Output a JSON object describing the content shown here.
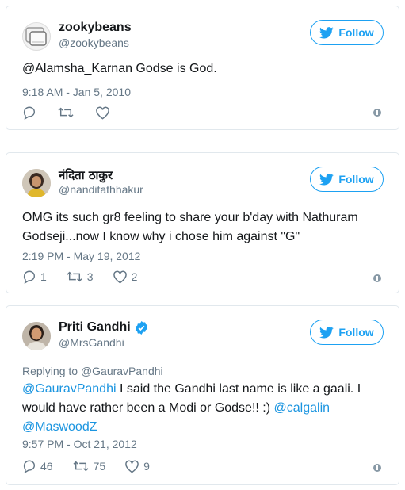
{
  "follow_label": "Follow",
  "tweets": [
    {
      "name": "zookybeans",
      "handle": "@zookybeans",
      "text": "@Alamsha_Karnan Godse is God.",
      "timestamp": "9:18 AM - Jan 5, 2010",
      "replies": "",
      "retweets": "",
      "likes": ""
    },
    {
      "name": "नंदिता ठाकुर",
      "handle": "@nanditathhakur",
      "text": "OMG its such gr8 feeling to share your b'day with Nathuram Godseji...now I know why i chose him against \"G\"",
      "timestamp": "2:19 PM - May 19, 2012",
      "replies": "1",
      "retweets": "3",
      "likes": "2"
    },
    {
      "name": "Priti Gandhi",
      "handle": "@MrsGandhi",
      "verified": true,
      "replying_to": "Replying to @GauravPandhi",
      "text_mention_1": "@GauravPandhi",
      "text_body": " I said the Gandhi last name is like a gaali. I would have rather been a Modi or Godse!! :) ",
      "text_mention_2": "@calgalin",
      "text_mention_3": "@MaswoodZ",
      "timestamp": "9:57 PM - Oct 21, 2012",
      "replies": "46",
      "retweets": "75",
      "likes": "9"
    }
  ],
  "colors": {
    "accent": "#1da1f2",
    "link": "#1b95e0",
    "muted": "#657786",
    "border": "#e1e8ed"
  }
}
